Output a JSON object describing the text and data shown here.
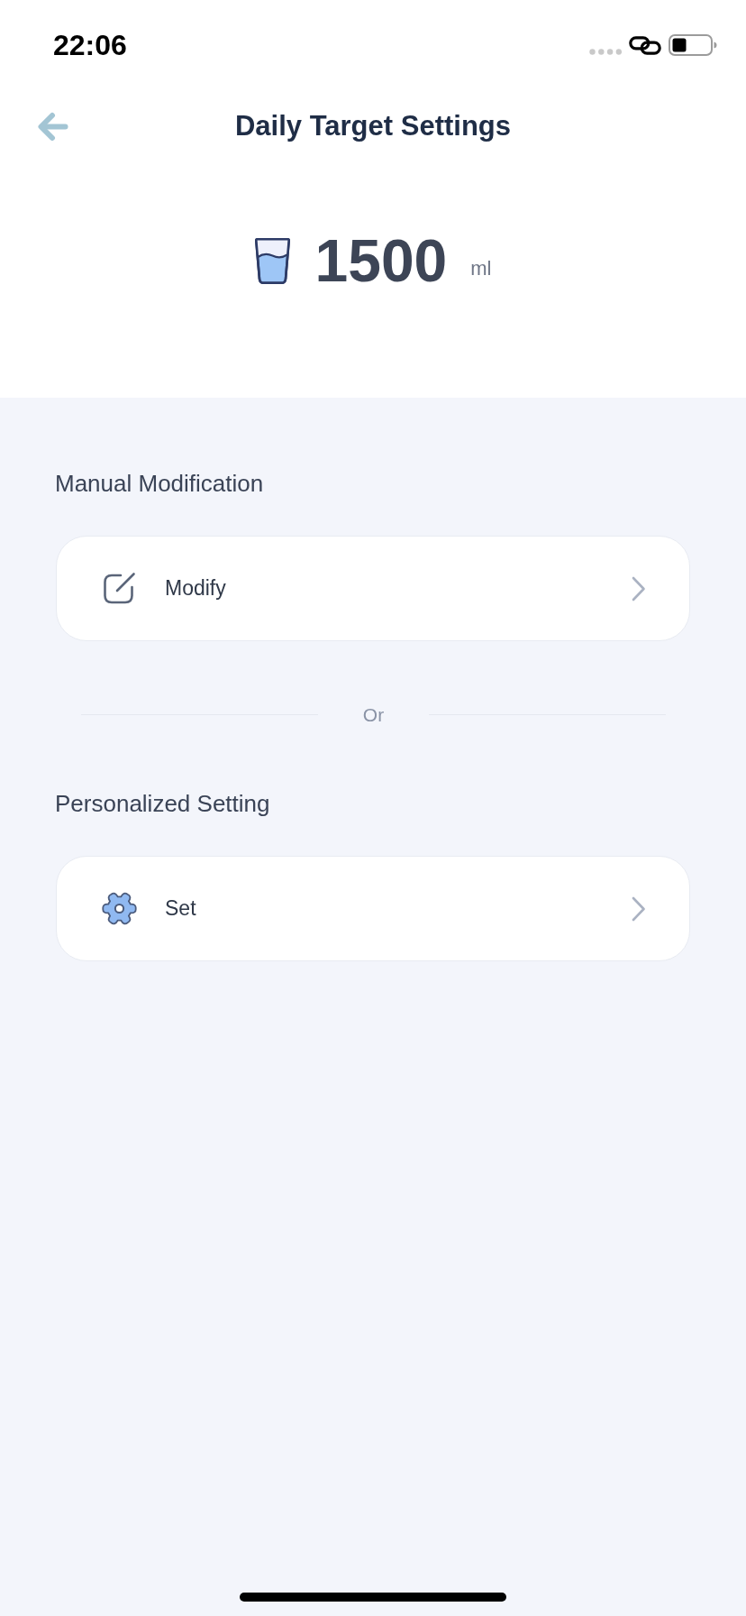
{
  "status_bar": {
    "time": "22:06"
  },
  "header": {
    "title": "Daily Target Settings"
  },
  "target": {
    "value": "1500",
    "unit": "ml"
  },
  "blocks": [
    {
      "kind": "section",
      "heading": "Manual Modification",
      "row": {
        "kind": "manual",
        "label": "Modify"
      }
    },
    {
      "kind": "divider",
      "label": "Or"
    },
    {
      "kind": "section",
      "heading": "Personalized Setting",
      "row": {
        "kind": "personalized",
        "label": "Set"
      }
    }
  ]
}
